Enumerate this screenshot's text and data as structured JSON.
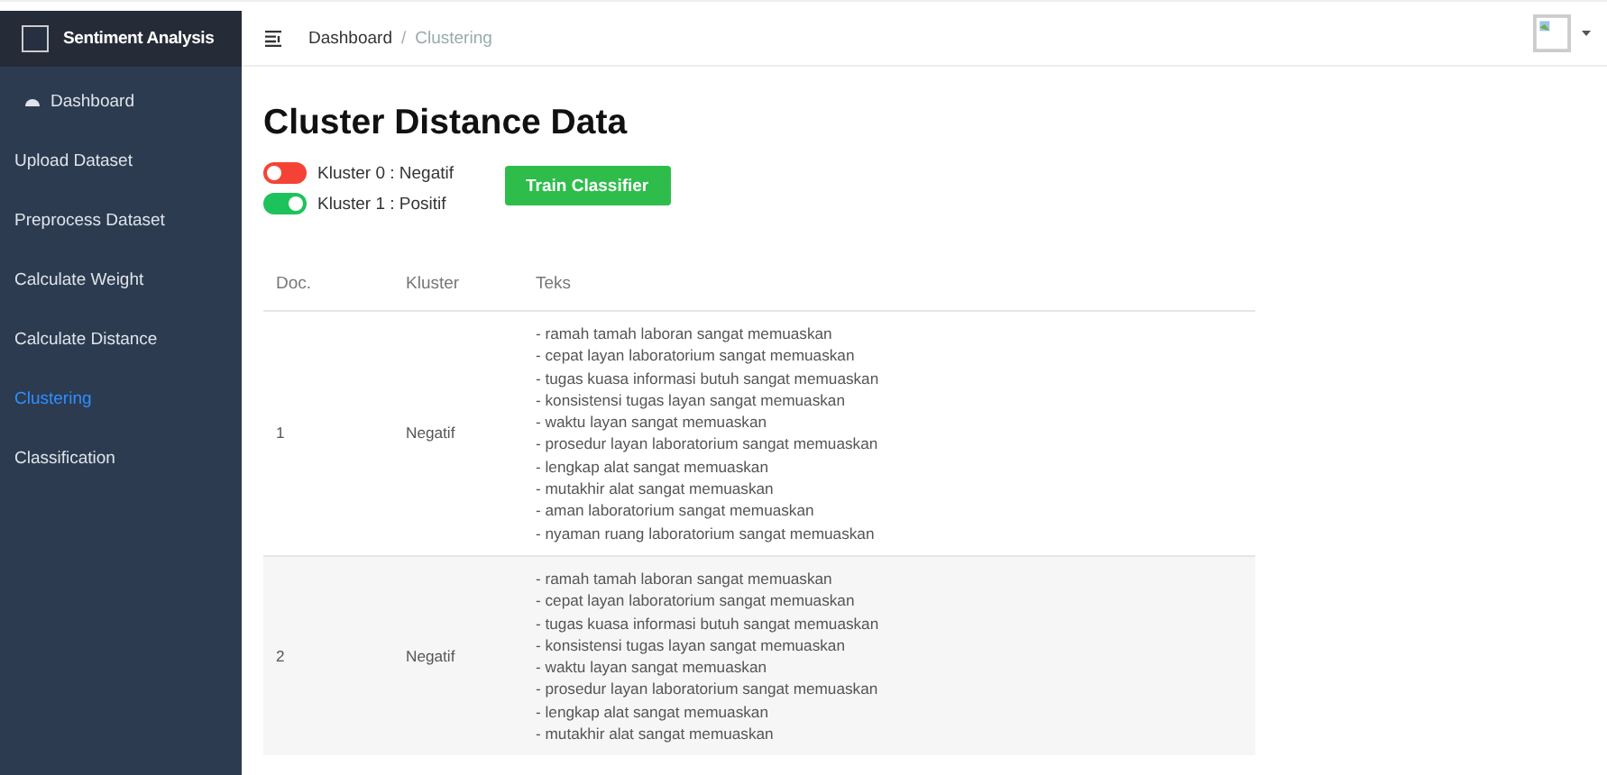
{
  "sidebar": {
    "brand": "Sentiment Analysis",
    "items": [
      {
        "label": "Dashboard",
        "kind": "icon",
        "selected": false
      },
      {
        "label": "Upload Dataset",
        "kind": "plain",
        "selected": false
      },
      {
        "label": "Preprocess Dataset",
        "kind": "plain",
        "selected": false
      },
      {
        "label": "Calculate Weight",
        "kind": "plain",
        "selected": false
      },
      {
        "label": "Calculate Distance",
        "kind": "plain",
        "selected": false
      },
      {
        "label": "Clustering",
        "kind": "plain",
        "selected": true
      },
      {
        "label": "Classification",
        "kind": "plain",
        "selected": false
      }
    ]
  },
  "breadcrumb": [
    "Dashboard",
    "/",
    "Clustering"
  ],
  "title": "Cluster Distance Data",
  "legend": [
    {
      "label": "Kluster 0 : Negatif",
      "on": false,
      "color": "#f44336"
    },
    {
      "label": "Kluster 1 : Positif",
      "on": true,
      "color": "#1ec25c"
    }
  ],
  "train_button": "Train Classifier",
  "table": {
    "columns": [
      "Doc.",
      "Kluster",
      "Teks"
    ],
    "rows": [
      {
        "doc": "1",
        "kluster": "Negatif",
        "teks": [
          "- ramah tamah laboran sangat memuaskan",
          "- cepat layan laboratorium sangat memuaskan",
          "- tugas kuasa informasi butuh sangat memuaskan",
          "- konsistensi tugas layan sangat memuaskan",
          "- waktu layan sangat memuaskan",
          "- prosedur layan laboratorium sangat memuaskan",
          "- lengkap alat sangat memuaskan",
          "- mutakhir alat sangat memuaskan",
          "- aman laboratorium sangat memuaskan",
          "- nyaman ruang laboratorium sangat memuaskan"
        ]
      },
      {
        "doc": "2",
        "kluster": "Negatif",
        "teks": [
          "- ramah tamah laboran sangat memuaskan",
          "- cepat layan laboratorium sangat memuaskan",
          "- tugas kuasa informasi butuh sangat memuaskan",
          "- konsistensi tugas layan sangat memuaskan",
          "- waktu layan sangat memuaskan",
          "- prosedur layan laboratorium sangat memuaskan",
          "- lengkap alat sangat memuaskan",
          "- mutakhir alat sangat memuaskan"
        ]
      }
    ]
  }
}
